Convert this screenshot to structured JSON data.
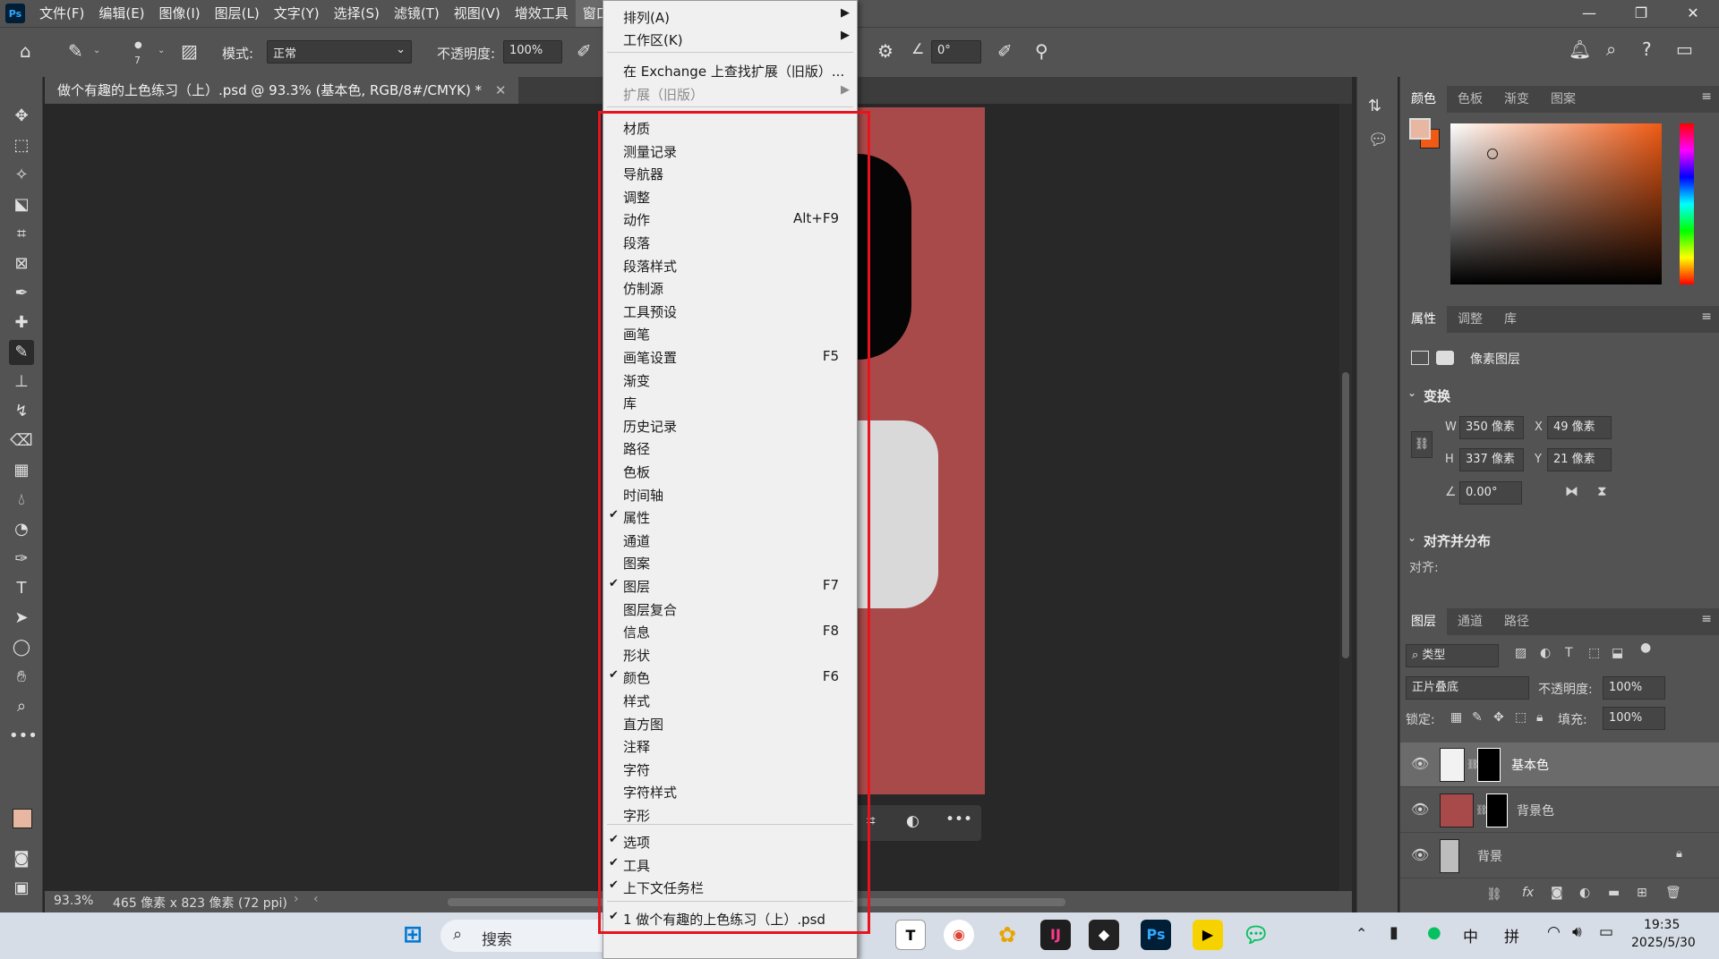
{
  "menubar": {
    "logo": "Ps",
    "items": [
      "文件(F)",
      "编辑(E)",
      "图像(I)",
      "图层(L)",
      "文字(Y)",
      "选择(S)",
      "滤镜(T)",
      "视图(V)",
      "增效工具",
      "窗口(W)"
    ]
  },
  "options": {
    "brush_size": "7",
    "mode_label": "模式:",
    "mode_value": "正常",
    "opacity_label": "不透明度:",
    "opacity_value": "100%",
    "angle_value": "0°"
  },
  "document": {
    "tab_title": "做个有趣的上色练习（上）.psd @ 93.3% (基本色, RGB/8#/CMYK) *",
    "zoom": "93.3%",
    "dimensions": "465 像素 x 823 像素 (72 ppi)"
  },
  "window_menu": {
    "top_items": [
      {
        "label": "排列(A)",
        "submenu": true,
        "disabled": false
      },
      {
        "label": "工作区(K)",
        "submenu": true,
        "disabled": false
      },
      {
        "label": "在 Exchange 上查找扩展（旧版）...",
        "submenu": false,
        "disabled": false
      },
      {
        "label": "扩展（旧版）",
        "submenu": true,
        "disabled": true
      }
    ],
    "panel_items": [
      {
        "label": "材质",
        "checked": false,
        "shortcut": ""
      },
      {
        "label": "测量记录",
        "checked": false,
        "shortcut": ""
      },
      {
        "label": "导航器",
        "checked": false,
        "shortcut": ""
      },
      {
        "label": "调整",
        "checked": false,
        "shortcut": ""
      },
      {
        "label": "动作",
        "checked": false,
        "shortcut": "Alt+F9"
      },
      {
        "label": "段落",
        "checked": false,
        "shortcut": ""
      },
      {
        "label": "段落样式",
        "checked": false,
        "shortcut": ""
      },
      {
        "label": "仿制源",
        "checked": false,
        "shortcut": ""
      },
      {
        "label": "工具预设",
        "checked": false,
        "shortcut": ""
      },
      {
        "label": "画笔",
        "checked": false,
        "shortcut": ""
      },
      {
        "label": "画笔设置",
        "checked": false,
        "shortcut": "F5"
      },
      {
        "label": "渐变",
        "checked": false,
        "shortcut": ""
      },
      {
        "label": "库",
        "checked": false,
        "shortcut": ""
      },
      {
        "label": "历史记录",
        "checked": false,
        "shortcut": ""
      },
      {
        "label": "路径",
        "checked": false,
        "shortcut": ""
      },
      {
        "label": "色板",
        "checked": false,
        "shortcut": ""
      },
      {
        "label": "时间轴",
        "checked": false,
        "shortcut": ""
      },
      {
        "label": "属性",
        "checked": true,
        "shortcut": ""
      },
      {
        "label": "通道",
        "checked": false,
        "shortcut": ""
      },
      {
        "label": "图案",
        "checked": false,
        "shortcut": ""
      },
      {
        "label": "图层",
        "checked": true,
        "shortcut": "F7"
      },
      {
        "label": "图层复合",
        "checked": false,
        "shortcut": ""
      },
      {
        "label": "信息",
        "checked": false,
        "shortcut": "F8"
      },
      {
        "label": "形状",
        "checked": false,
        "shortcut": ""
      },
      {
        "label": "颜色",
        "checked": true,
        "shortcut": "F6"
      },
      {
        "label": "样式",
        "checked": false,
        "shortcut": ""
      },
      {
        "label": "直方图",
        "checked": false,
        "shortcut": ""
      },
      {
        "label": "注释",
        "checked": false,
        "shortcut": ""
      },
      {
        "label": "字符",
        "checked": false,
        "shortcut": ""
      },
      {
        "label": "字符样式",
        "checked": false,
        "shortcut": ""
      },
      {
        "label": "字形",
        "checked": false,
        "shortcut": ""
      }
    ],
    "bottom_items": [
      {
        "label": "选项",
        "checked": true
      },
      {
        "label": "工具",
        "checked": true
      },
      {
        "label": "上下文任务栏",
        "checked": true
      }
    ],
    "document_item": "1 做个有趣的上色练习（上）.psd"
  },
  "color_panel": {
    "tabs": [
      "颜色",
      "色板",
      "渐变",
      "图案"
    ],
    "foreground": "#e8b7a2",
    "background": "#f05a14"
  },
  "properties_panel": {
    "tabs": [
      "属性",
      "调整",
      "库"
    ],
    "type_label": "像素图层",
    "transform_title": "变换",
    "w_label": "W",
    "w_value": "350 像素",
    "h_label": "H",
    "h_value": "337 像素",
    "x_label": "X",
    "x_value": "49 像素",
    "y_label": "Y",
    "y_value": "21 像素",
    "angle_value": "0.00°",
    "align_title": "对齐并分布",
    "align_label": "对齐:"
  },
  "layers_panel": {
    "tabs": [
      "图层",
      "通道",
      "路径"
    ],
    "filter_value": "类型",
    "blend_mode": "正片叠底",
    "opacity_label": "不透明度:",
    "opacity_value": "100%",
    "lock_label": "锁定:",
    "fill_label": "填充:",
    "fill_value": "100%",
    "layers": [
      {
        "name": "基本色",
        "selected": true
      },
      {
        "name": "背景色",
        "selected": false
      },
      {
        "name": "背景",
        "selected": false
      }
    ]
  },
  "taskbar": {
    "search_placeholder": "搜索",
    "ime_lang": "中",
    "ime_mode": "拼",
    "time": "19:35",
    "date": "2025/5/30"
  },
  "colors": {
    "highlight": "#e8141d",
    "artboard": "#a84a4a"
  }
}
